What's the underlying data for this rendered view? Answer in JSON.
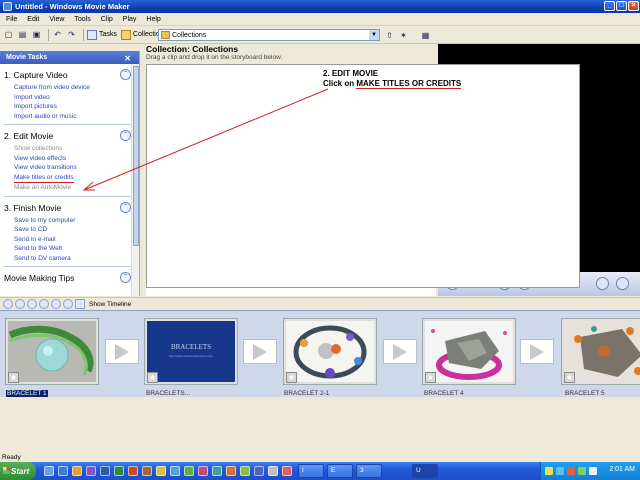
{
  "window": {
    "title": "Untitled - Windows Movie Maker"
  },
  "menu": [
    "File",
    "Edit",
    "View",
    "Tools",
    "Clip",
    "Play",
    "Help"
  ],
  "toolbar": {
    "tasks_label": "Tasks",
    "collections_label": "Collections",
    "collection_select": "Collections"
  },
  "taskpane": {
    "title": "Movie Tasks",
    "sections": [
      {
        "title": "1. Capture Video",
        "items": [
          {
            "label": "Capture from video device",
            "enabled": true
          },
          {
            "label": "Import video",
            "enabled": true
          },
          {
            "label": "Import pictures",
            "enabled": true
          },
          {
            "label": "Import audio or music",
            "enabled": true
          }
        ]
      },
      {
        "title": "2. Edit Movie",
        "items": [
          {
            "label": "Show collections",
            "enabled": false
          },
          {
            "label": "View video effects",
            "enabled": true
          },
          {
            "label": "View video transitions",
            "enabled": true
          },
          {
            "label": "Make titles or credits",
            "enabled": true
          },
          {
            "label": "Make an AutoMovie",
            "enabled": false
          }
        ]
      },
      {
        "title": "3. Finish Movie",
        "items": [
          {
            "label": "Save to my computer",
            "enabled": true
          },
          {
            "label": "Save to CD",
            "enabled": true
          },
          {
            "label": "Send in e-mail",
            "enabled": true
          },
          {
            "label": "Send to the Web",
            "enabled": true
          },
          {
            "label": "Send to DV camera",
            "enabled": true
          }
        ]
      },
      {
        "title": "Movie Making Tips",
        "items": []
      }
    ]
  },
  "collection": {
    "title": "Collection: Collections",
    "subtitle": "Drag a clip and drop it on the storyboard below."
  },
  "instruction": {
    "line1": "2. EDIT MOVIE",
    "line2_prefix": "Click on ",
    "line2_emphasis": "MAKE TITLES OR CREDITS"
  },
  "storyboard": {
    "show_timeline_label": "Show Timeline",
    "clips": [
      {
        "label": "BRACELET 1",
        "selected": true,
        "thumb": "green-bracelet"
      },
      {
        "label": "BRACELETS...",
        "selected": false,
        "thumb": "title-card",
        "card_title": "BRACELETS",
        "card_sub": "http://www.ambassadorstore.com"
      },
      {
        "label": "BRACELET 2-1",
        "selected": false,
        "thumb": "bead-bracelet"
      },
      {
        "label": "BRACELET 4",
        "selected": false,
        "thumb": "pink-stone-bracelet"
      },
      {
        "label": "BRACELET 5",
        "selected": false,
        "thumb": "orange-stone-bracelet"
      }
    ]
  },
  "status": {
    "text": "Ready"
  },
  "taskbar": {
    "start_label": "Start",
    "windows": [
      "I",
      "E",
      "3",
      "U"
    ],
    "clock": "2:01 AM"
  }
}
